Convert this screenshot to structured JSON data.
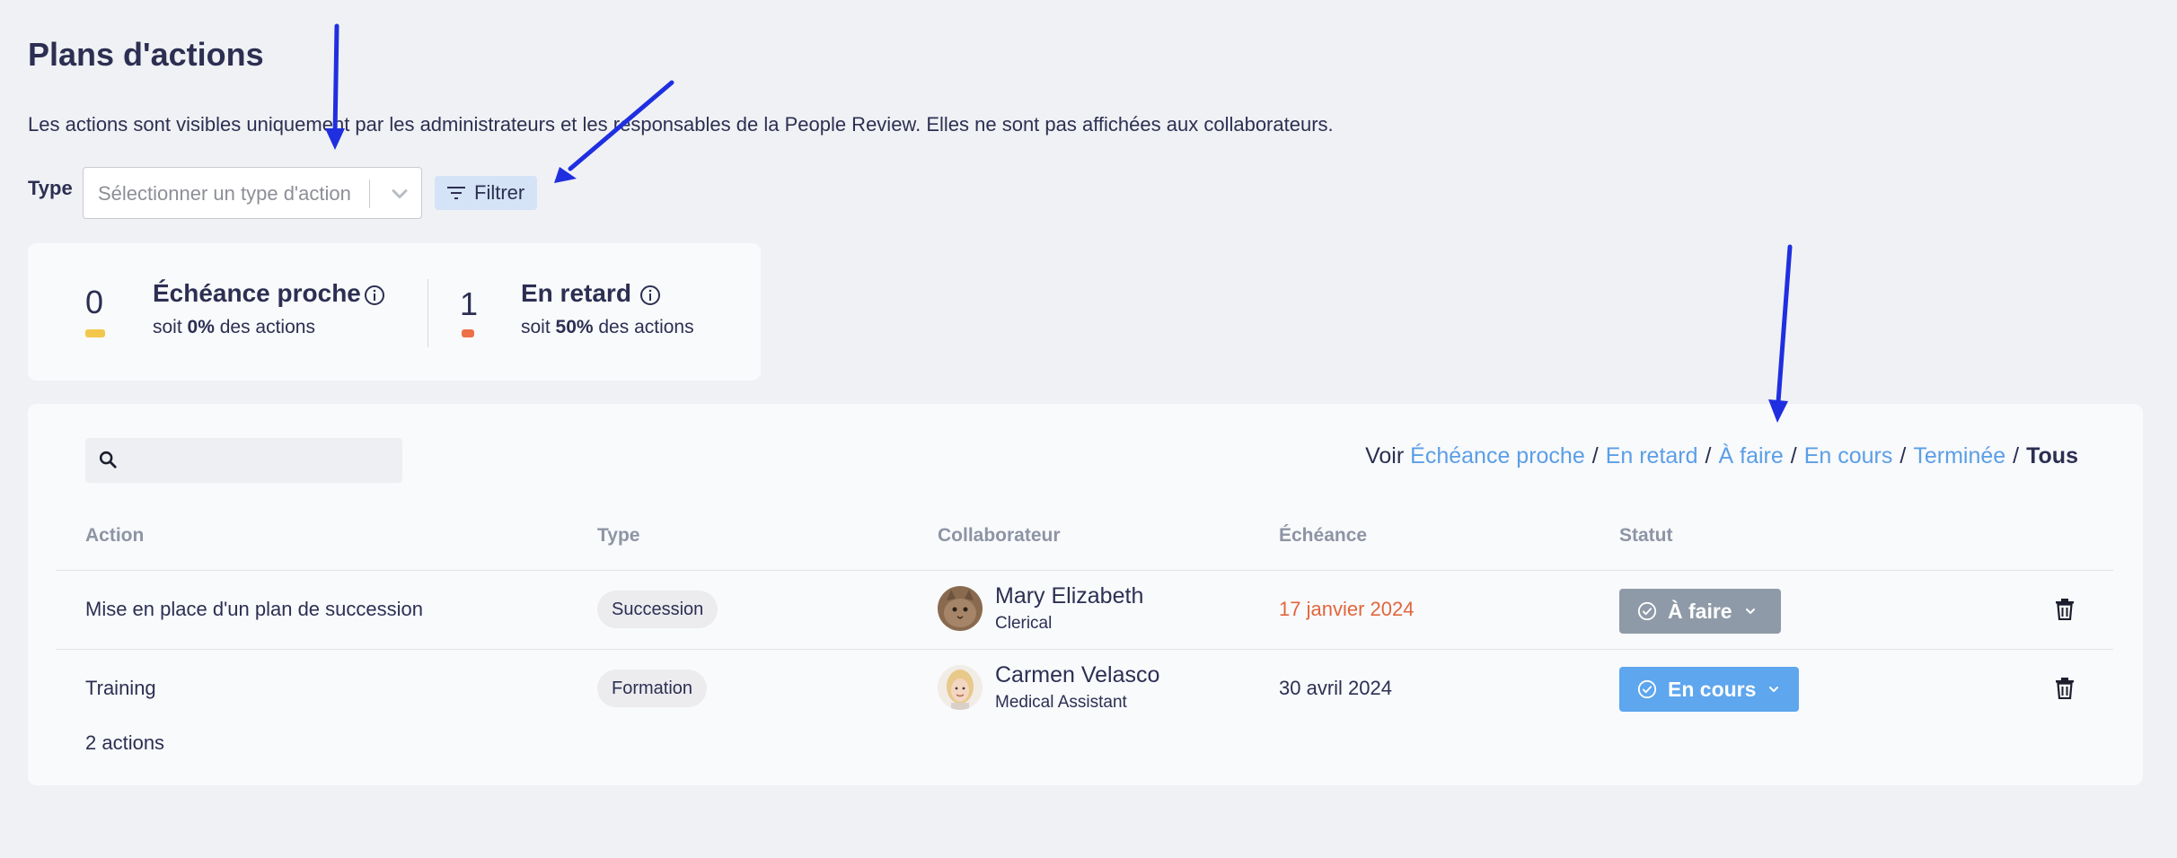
{
  "page": {
    "title": "Plans d'actions",
    "description": "Les actions sont visibles uniquement par les administrateurs et les responsables de la People Review. Elles ne sont pas affichées aux collaborateurs."
  },
  "filters": {
    "type_label": "Type",
    "select_placeholder": "Sélectionner un type d'action",
    "filter_button": "Filtrer"
  },
  "kpis": {
    "due_soon": {
      "count": "0",
      "title": "Échéance proche",
      "prefix": "soit ",
      "percent": "0%",
      "suffix": " des actions",
      "color": "#f3c74b"
    },
    "late": {
      "count": "1",
      "title": "En retard",
      "prefix": "soit ",
      "percent": "50%",
      "suffix": " des actions",
      "color": "#ee7049"
    }
  },
  "table": {
    "view": {
      "label": "Voir",
      "links": [
        "Échéance proche",
        "En retard",
        "À faire",
        "En cours",
        "Terminée"
      ],
      "separator": "/",
      "active": "Tous"
    },
    "columns": [
      "Action",
      "Type",
      "Collaborateur",
      "Échéance",
      "Statut"
    ],
    "rows": [
      {
        "action": "Mise en place d'un plan de succession",
        "type": "Succession",
        "name": "Mary Elizabeth",
        "role": "Clerical",
        "due": "17 janvier 2024",
        "due_color": "#e0663c",
        "status": "À faire",
        "status_color": "#8e9aa8"
      },
      {
        "action": "Training",
        "type": "Formation",
        "name": "Carmen Velasco",
        "role": "Medical Assistant",
        "due": "30 avril 2024",
        "due_color": "#2c2f52",
        "status": "En cours",
        "status_color": "#5ea6ee"
      }
    ],
    "count_label": "2 actions"
  },
  "colors": {
    "accent_link": "#5b9ee6",
    "annotation_arrow": "#1f2fe0"
  },
  "icons": [
    "chevron-down-icon",
    "filter-icon",
    "info-icon",
    "search-icon",
    "check-circle-icon",
    "trash-icon"
  ]
}
